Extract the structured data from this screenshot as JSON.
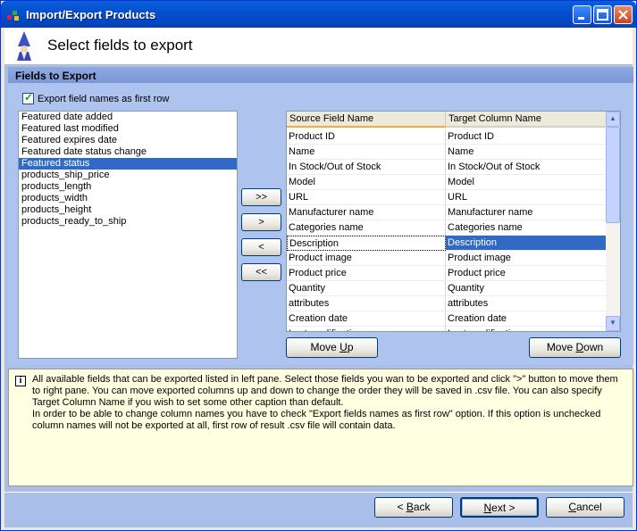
{
  "window": {
    "title": "Import/Export Products"
  },
  "header": {
    "title": "Select fields to export"
  },
  "section": {
    "title": "Fields to Export"
  },
  "export_names_checkbox": {
    "label": "Export field names as first row",
    "checked": true
  },
  "available_fields": [
    "Featured date added",
    "Featured last modified",
    "Featured expires date",
    "Featured date status change",
    "Featured status",
    "products_ship_price",
    "products_length",
    "products_width",
    "products_height",
    "products_ready_to_ship"
  ],
  "available_selected": "Featured status",
  "move_buttons": {
    "add_all": ">>",
    "add": ">",
    "remove": "<",
    "remove_all": "<<"
  },
  "grid": {
    "col_source": "Source Field Name",
    "col_target": "Target Column Name",
    "rows": [
      {
        "source": "Product ID",
        "target": "Product ID"
      },
      {
        "source": "Name",
        "target": "Name"
      },
      {
        "source": "In Stock/Out of Stock",
        "target": "In Stock/Out of Stock"
      },
      {
        "source": "Model",
        "target": "Model"
      },
      {
        "source": "URL",
        "target": "URL"
      },
      {
        "source": "Manufacturer name",
        "target": "Manufacturer name"
      },
      {
        "source": "Categories name",
        "target": "Categories name"
      },
      {
        "source": "Description",
        "target": "Description"
      },
      {
        "source": "Product image",
        "target": "Product image"
      },
      {
        "source": "Product price",
        "target": "Product price"
      },
      {
        "source": "Quantity",
        "target": "Quantity"
      },
      {
        "source": "attributes",
        "target": "attributes"
      },
      {
        "source": "Creation date",
        "target": "Creation date"
      },
      {
        "source": "Last modification",
        "target": "Last modification"
      }
    ],
    "selected_row": "Description"
  },
  "move_up": {
    "pre": "Move ",
    "key": "U",
    "post": "p"
  },
  "move_down": {
    "pre": "Move ",
    "key": "D",
    "post": "own"
  },
  "info": {
    "paragraph1": "All available fields that can be exported listed in left pane. Select those fields you wan to be exported and click \">\" button to move them to right pane. You can move exported columns up and down to change the order they will be saved in .csv file. You can also specify Target Column Name if you wish to set some other caption than default.",
    "paragraph2": "In order to be able to change column names you have to check \"Export fields names as first row\" option. If this option is unchecked column names will not be exported at all, first row of result .csv file will contain data."
  },
  "footer": {
    "back": {
      "pre": "< ",
      "key": "B",
      "post": "ack"
    },
    "next": {
      "pre": "",
      "key": "N",
      "post": "ext >"
    },
    "cancel": {
      "pre": "",
      "key": "C",
      "post": "ancel"
    }
  }
}
